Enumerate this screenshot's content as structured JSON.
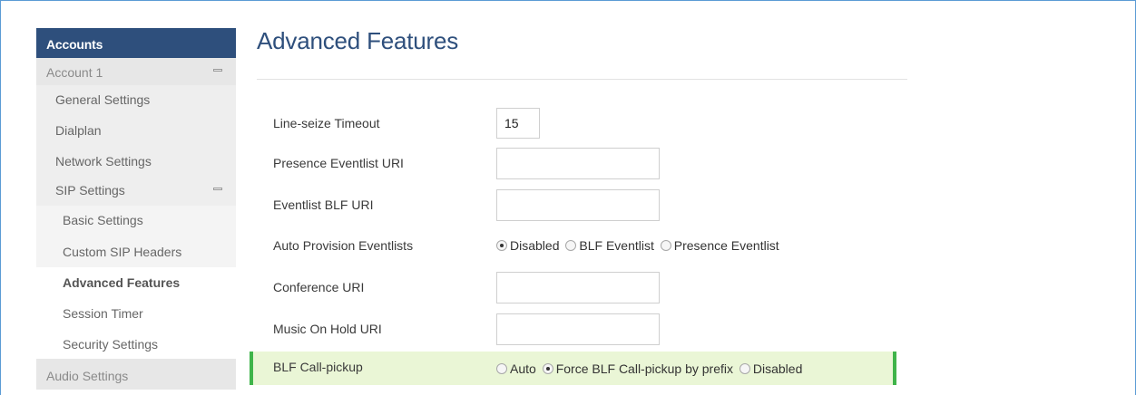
{
  "sidebar": {
    "header": "Accounts",
    "account": "Account 1",
    "items": {
      "general": "General Settings",
      "dialplan": "Dialplan",
      "network": "Network Settings",
      "sip": "SIP Settings",
      "basic": "Basic Settings",
      "custom_headers": "Custom SIP Headers",
      "advanced": "Advanced Features",
      "session_timer": "Session Timer",
      "security": "Security Settings",
      "audio": "Audio Settings"
    }
  },
  "main": {
    "title": "Advanced Features",
    "fields": {
      "line_seize": {
        "label": "Line-seize Timeout",
        "value": "15"
      },
      "presence_uri": {
        "label": "Presence Eventlist URI",
        "value": ""
      },
      "blf_uri": {
        "label": "Eventlist BLF URI",
        "value": ""
      },
      "auto_provision": {
        "label": "Auto Provision Eventlists",
        "options": [
          "Disabled",
          "BLF Eventlist",
          "Presence Eventlist"
        ],
        "selected": "Disabled"
      },
      "conference_uri": {
        "label": "Conference URI",
        "value": ""
      },
      "moh_uri": {
        "label": "Music On Hold URI",
        "value": ""
      },
      "blf_pickup": {
        "label": "BLF Call-pickup",
        "options": [
          "Auto",
          "Force BLF Call-pickup by prefix",
          "Disabled"
        ],
        "selected": "Force BLF Call-pickup by prefix"
      }
    }
  },
  "colors": {
    "header_bg": "#2e4f7c",
    "title": "#2e4f7c",
    "highlight_bg": "#eaf6d6",
    "highlight_border": "#3fb44a"
  }
}
